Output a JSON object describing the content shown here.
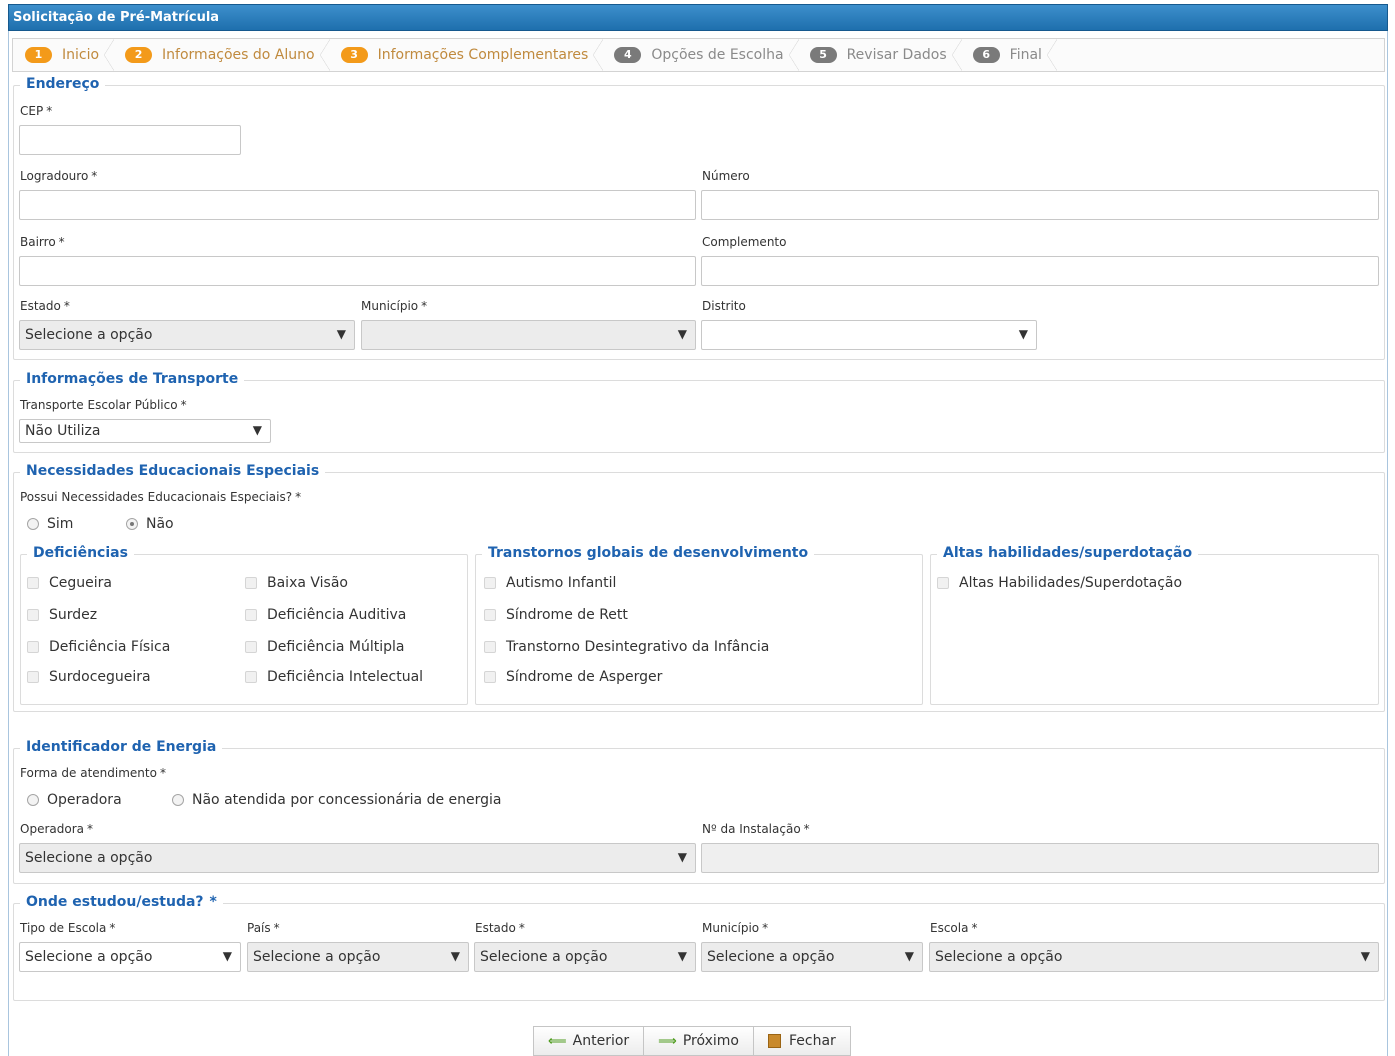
{
  "window": {
    "title": "Solicitação de Pré-Matrícula"
  },
  "steps": [
    {
      "num": "1",
      "label": "Inicio",
      "state": "done"
    },
    {
      "num": "2",
      "label": "Informações do Aluno",
      "state": "done"
    },
    {
      "num": "3",
      "label": "Informações Complementares",
      "state": "current"
    },
    {
      "num": "4",
      "label": "Opções de Escolha",
      "state": "pending"
    },
    {
      "num": "5",
      "label": "Revisar Dados",
      "state": "pending"
    },
    {
      "num": "6",
      "label": "Final",
      "state": "pending"
    }
  ],
  "required_mark": "*",
  "endereco": {
    "legend": "Endereço",
    "cep": {
      "label": "CEP",
      "value": ""
    },
    "logradouro": {
      "label": "Logradouro",
      "value": ""
    },
    "numero": {
      "label": "Número",
      "value": ""
    },
    "bairro": {
      "label": "Bairro",
      "value": ""
    },
    "complemento": {
      "label": "Complemento",
      "value": ""
    },
    "estado": {
      "label": "Estado",
      "value": "Selecione a opção"
    },
    "municipio": {
      "label": "Município",
      "value": ""
    },
    "distrito": {
      "label": "Distrito",
      "value": ""
    }
  },
  "transporte": {
    "legend": "Informações de Transporte",
    "label": "Transporte Escolar Público",
    "value": "Não Utiliza"
  },
  "nee": {
    "legend": "Necessidades Educacionais Especiais",
    "question": "Possui Necessidades Educacionais Especiais?",
    "options": [
      {
        "label": "Sim",
        "checked": false
      },
      {
        "label": "Não",
        "checked": true
      }
    ],
    "deficiencias": {
      "legend": "Deficiências",
      "items": [
        "Cegueira",
        "Baixa Visão",
        "Surdez",
        "Deficiência Auditiva",
        "Deficiência Física",
        "Deficiência Múltipla",
        "Surdocegueira",
        "Deficiência Intelectual"
      ]
    },
    "transtornos": {
      "legend": "Transtornos globais de desenvolvimento",
      "items": [
        "Autismo Infantil",
        "Síndrome de Rett",
        "Transtorno Desintegrativo da Infância",
        "Síndrome de Asperger"
      ]
    },
    "altas": {
      "legend": "Altas habilidades/superdotação",
      "items": [
        "Altas Habilidades/Superdotação"
      ]
    }
  },
  "energia": {
    "legend": "Identificador de Energia",
    "forma_label": "Forma de atendimento",
    "options": [
      {
        "label": "Operadora"
      },
      {
        "label": "Não atendida por concessionária de energia"
      }
    ],
    "operadora": {
      "label": "Operadora",
      "value": "Selecione a opção"
    },
    "instalacao": {
      "label": "Nº da Instalação",
      "value": ""
    }
  },
  "estudo": {
    "legend": "Onde estudou/estuda?",
    "tipo": {
      "label": "Tipo de Escola",
      "value": "Selecione a opção"
    },
    "pais": {
      "label": "País",
      "value": "Selecione a opção"
    },
    "estado": {
      "label": "Estado",
      "value": "Selecione a opção"
    },
    "municipio": {
      "label": "Município",
      "value": "Selecione a opção"
    },
    "escola": {
      "label": "Escola",
      "value": "Selecione a opção"
    }
  },
  "buttons": {
    "anterior": "Anterior",
    "proximo": "Próximo",
    "fechar": "Fechar"
  },
  "icons": {
    "arrow": "▼",
    "left": "⟸",
    "right": "⟹"
  },
  "colors": {
    "title_bar": "#1e6fad",
    "legend": "#1f63b0",
    "step_done_badge": "#f39a1a",
    "step_pending_badge": "#7a7a7a"
  }
}
